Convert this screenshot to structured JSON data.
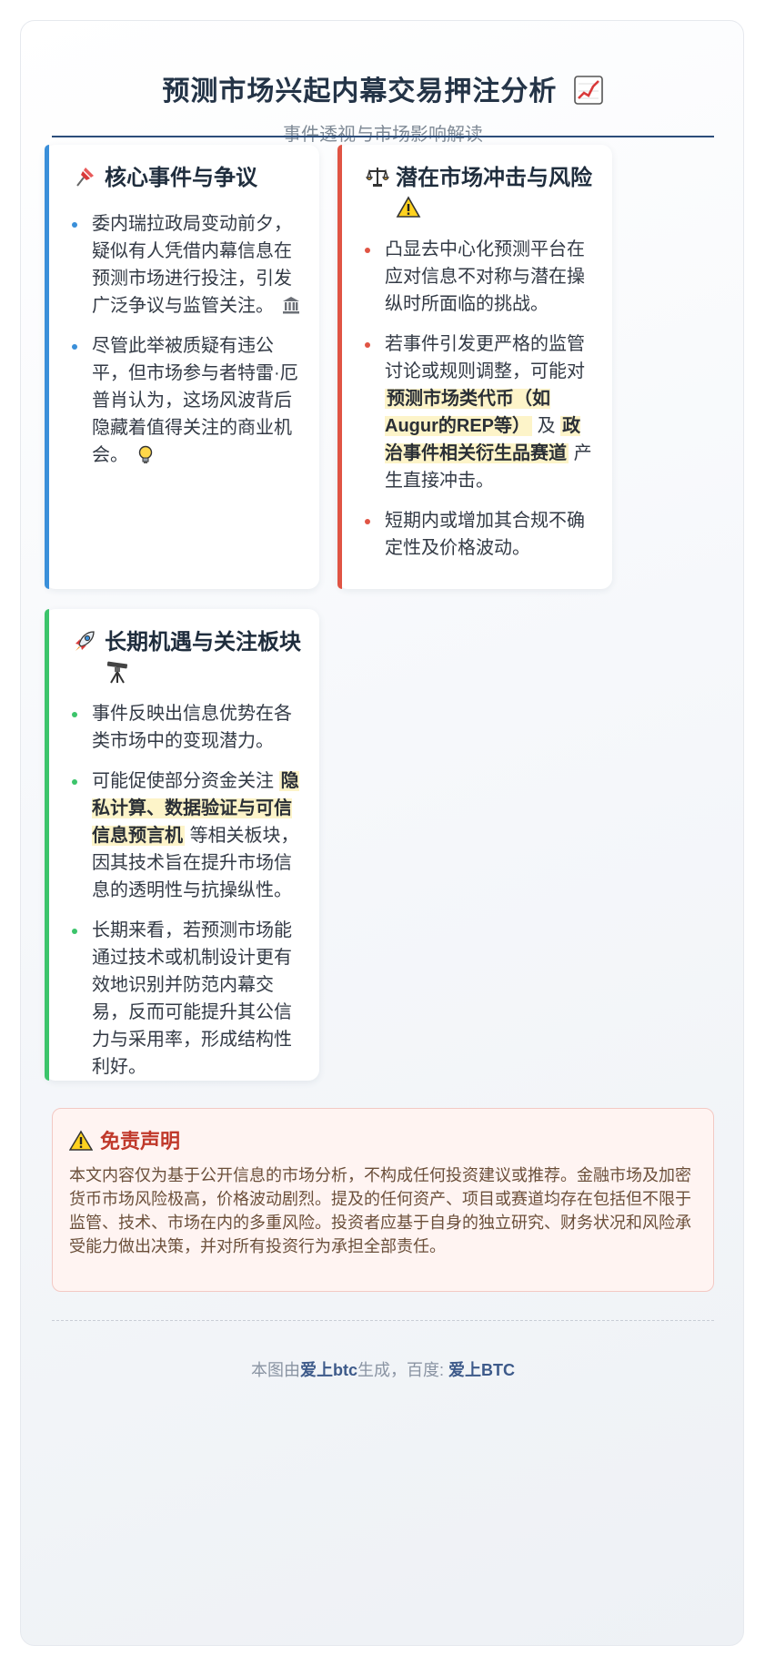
{
  "header": {
    "title": "预测市场兴起内幕交易押注分析",
    "title_icon": "chart-increasing-icon",
    "subtitle": "事件透视与市场影响解读"
  },
  "colors": {
    "accent_blue": "#3a8fd9",
    "accent_red": "#e05444",
    "accent_green": "#3cc46b",
    "highlight_bg": "#fdf4c9",
    "divider": "#2c4d7a"
  },
  "cards": {
    "core": {
      "icon": "pushpin-icon",
      "title": "核心事件与争议",
      "items": [
        {
          "text": "委内瑞拉政局变动前夕，疑似有人凭借内幕信息在预测市场进行投注，引发广泛争议与监管关注。",
          "icon": "classical-building-icon"
        },
        {
          "text": "尽管此举被质疑有违公平，但市场参与者特雷·厄普肖认为，这场风波背后隐藏着值得关注的商业机会。",
          "icon": "light-bulb-icon"
        }
      ]
    },
    "risk": {
      "icon": "balance-scale-icon",
      "title": "潜在市场冲击与风险",
      "title_icon2": "warning-icon",
      "items": [
        {
          "text": "凸显去中心化预测平台在应对信息不对称与潜在操纵时所面临的挑战。"
        },
        {
          "pre": "若事件引发更严格的监管讨论或规则调整，可能对",
          "hl1": "预测市场类代币（如Augur的REP等）",
          "mid": "及",
          "hl2": "政治事件相关衍生品赛道",
          "post": "产生直接冲击。"
        },
        {
          "text": "短期内或增加其合规不确定性及价格波动。"
        }
      ]
    },
    "long": {
      "icon": "rocket-icon",
      "title": "长期机遇与关注板块",
      "title_icon2": "telescope-icon",
      "items": [
        {
          "text": "事件反映出信息优势在各类市场中的变现潜力。"
        },
        {
          "pre": "可能促使部分资金关注",
          "hl1": "隐私计算、数据验证与可信信息预言机",
          "post": "等相关板块，因其技术旨在提升市场信息的透明性与抗操纵性。"
        },
        {
          "text": "长期来看，若预测市场能通过技术或机制设计更有效地识别并防范内幕交易，反而可能提升其公信力与采用率，形成结构性利好。"
        }
      ]
    }
  },
  "disclaimer": {
    "icon": "warning-icon",
    "title": "免责声明",
    "text": "本文内容仅为基于公开信息的市场分析，不构成任何投资建议或推荐。金融市场及加密货币市场风险极高，价格波动剧烈。提及的任何资产、项目或赛道均存在包括但不限于监管、技术、市场在内的多重风险。投资者应基于自身的独立研究、财务状况和风险承受能力做出决策，并对所有投资行为承担全部责任。"
  },
  "footer": {
    "prefix": "本图由",
    "brand1": "爱上btc",
    "middle": "生成，百度: ",
    "brand2": "爱上BTC"
  }
}
